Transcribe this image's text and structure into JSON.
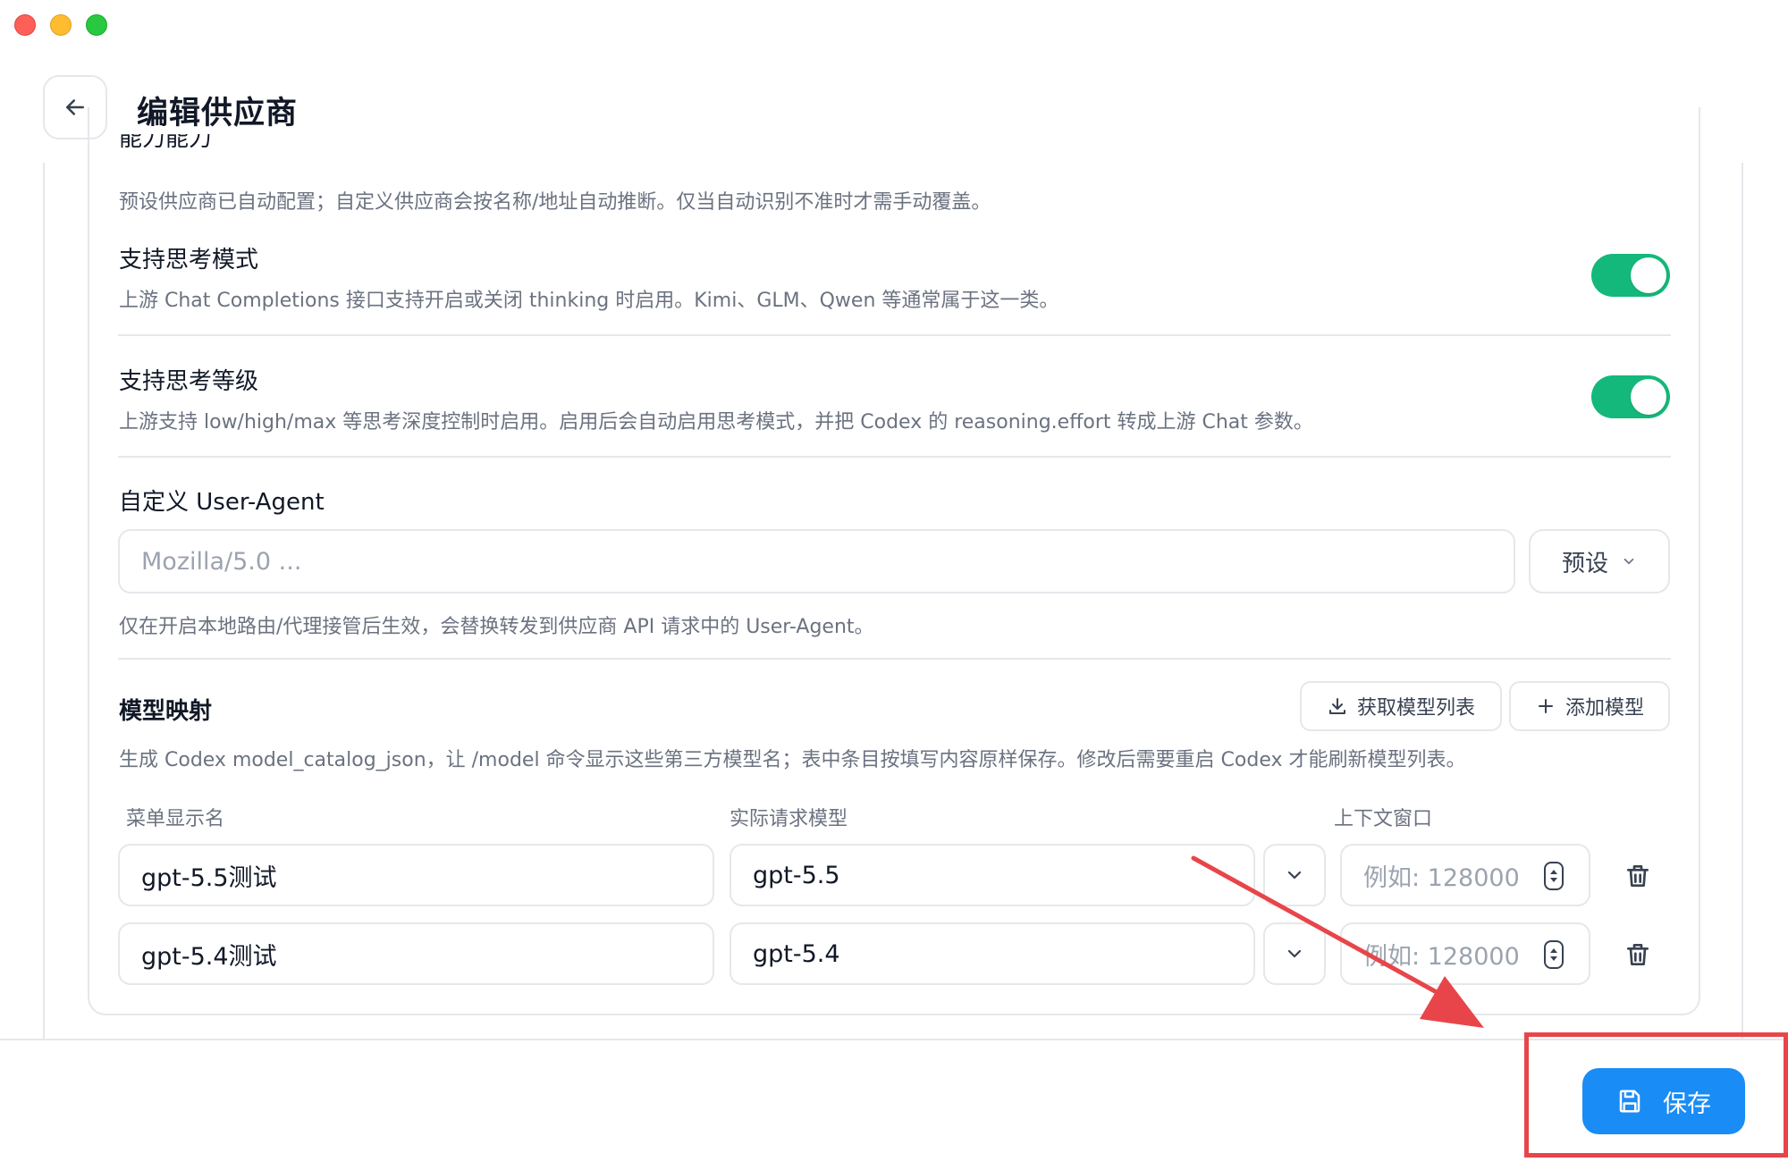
{
  "window": {
    "title_hidden": ""
  },
  "header": {
    "title": "编辑供应商"
  },
  "capabilities": {
    "section_title_clipped": "能力能力",
    "section_desc": "预设供应商已自动配置；自定义供应商会按名称/地址自动推断。仅当自动识别不准时才需手动覆盖。",
    "thinking_mode": {
      "label": "支持思考模式",
      "desc": "上游 Chat Completions 接口支持开启或关闭 thinking 时启用。Kimi、GLM、Qwen 等通常属于这一类。",
      "enabled": true
    },
    "thinking_level": {
      "label": "支持思考等级",
      "desc": "上游支持 low/high/max 等思考深度控制时启用。启用后会自动启用思考模式，并把 Codex 的 reasoning.effort 转成上游 Chat 参数。",
      "enabled": true
    }
  },
  "user_agent": {
    "label": "自定义 User-Agent",
    "placeholder": "Mozilla/5.0 ...",
    "preset_label": "预设",
    "desc": "仅在开启本地路由/代理接管后生效，会替换转发到供应商 API 请求中的 User-Agent。"
  },
  "model_mapping": {
    "label": "模型映射",
    "fetch_button": "获取模型列表",
    "add_button": "添加模型",
    "desc": "生成 Codex model_catalog_json，让 /model 命令显示这些第三方模型名；表中条目按填写内容原样保存。修改后需要重启 Codex 才能刷新模型列表。",
    "columns": [
      "菜单显示名",
      "实际请求模型",
      "上下文窗口"
    ],
    "rows": [
      {
        "display_name": "gpt-5.5测试",
        "request_model": "gpt-5.5",
        "context_placeholder": "例如: 128000"
      },
      {
        "display_name": "gpt-5.4测试",
        "request_model": "gpt-5.4",
        "context_placeholder": "例如: 128000"
      }
    ]
  },
  "footer": {
    "save_label": "保存"
  },
  "colors": {
    "accent": "#1a8cf5",
    "toggle_on": "#14b87a",
    "annotation": "#e8454a"
  }
}
